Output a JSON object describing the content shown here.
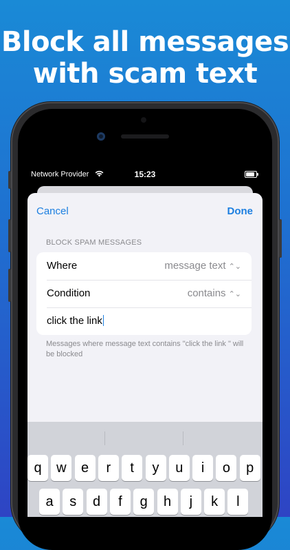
{
  "headline": {
    "line1": "Block all messages",
    "line2": "with scam text"
  },
  "status_bar": {
    "carrier": "Network Provider",
    "time": "15:23",
    "battery_level": 1.0
  },
  "nav": {
    "cancel": "Cancel",
    "done": "Done"
  },
  "form": {
    "section_header": "BLOCK SPAM MESSAGES",
    "where_label": "Where",
    "where_value": "message text",
    "condition_label": "Condition",
    "condition_value": "contains",
    "text_value": "click the link",
    "footer": "Messages where message text contains \"click the link \" will be blocked"
  },
  "keyboard": {
    "row1": [
      "q",
      "w",
      "e",
      "r",
      "t",
      "y",
      "u",
      "i",
      "o",
      "p"
    ],
    "row2": [
      "a",
      "s",
      "d",
      "f",
      "g",
      "h",
      "j",
      "k",
      "l"
    ]
  },
  "colors": {
    "accent": "#1c7fe0",
    "background_top": "#1a8ad6",
    "background_bottom": "#2e44c4"
  }
}
